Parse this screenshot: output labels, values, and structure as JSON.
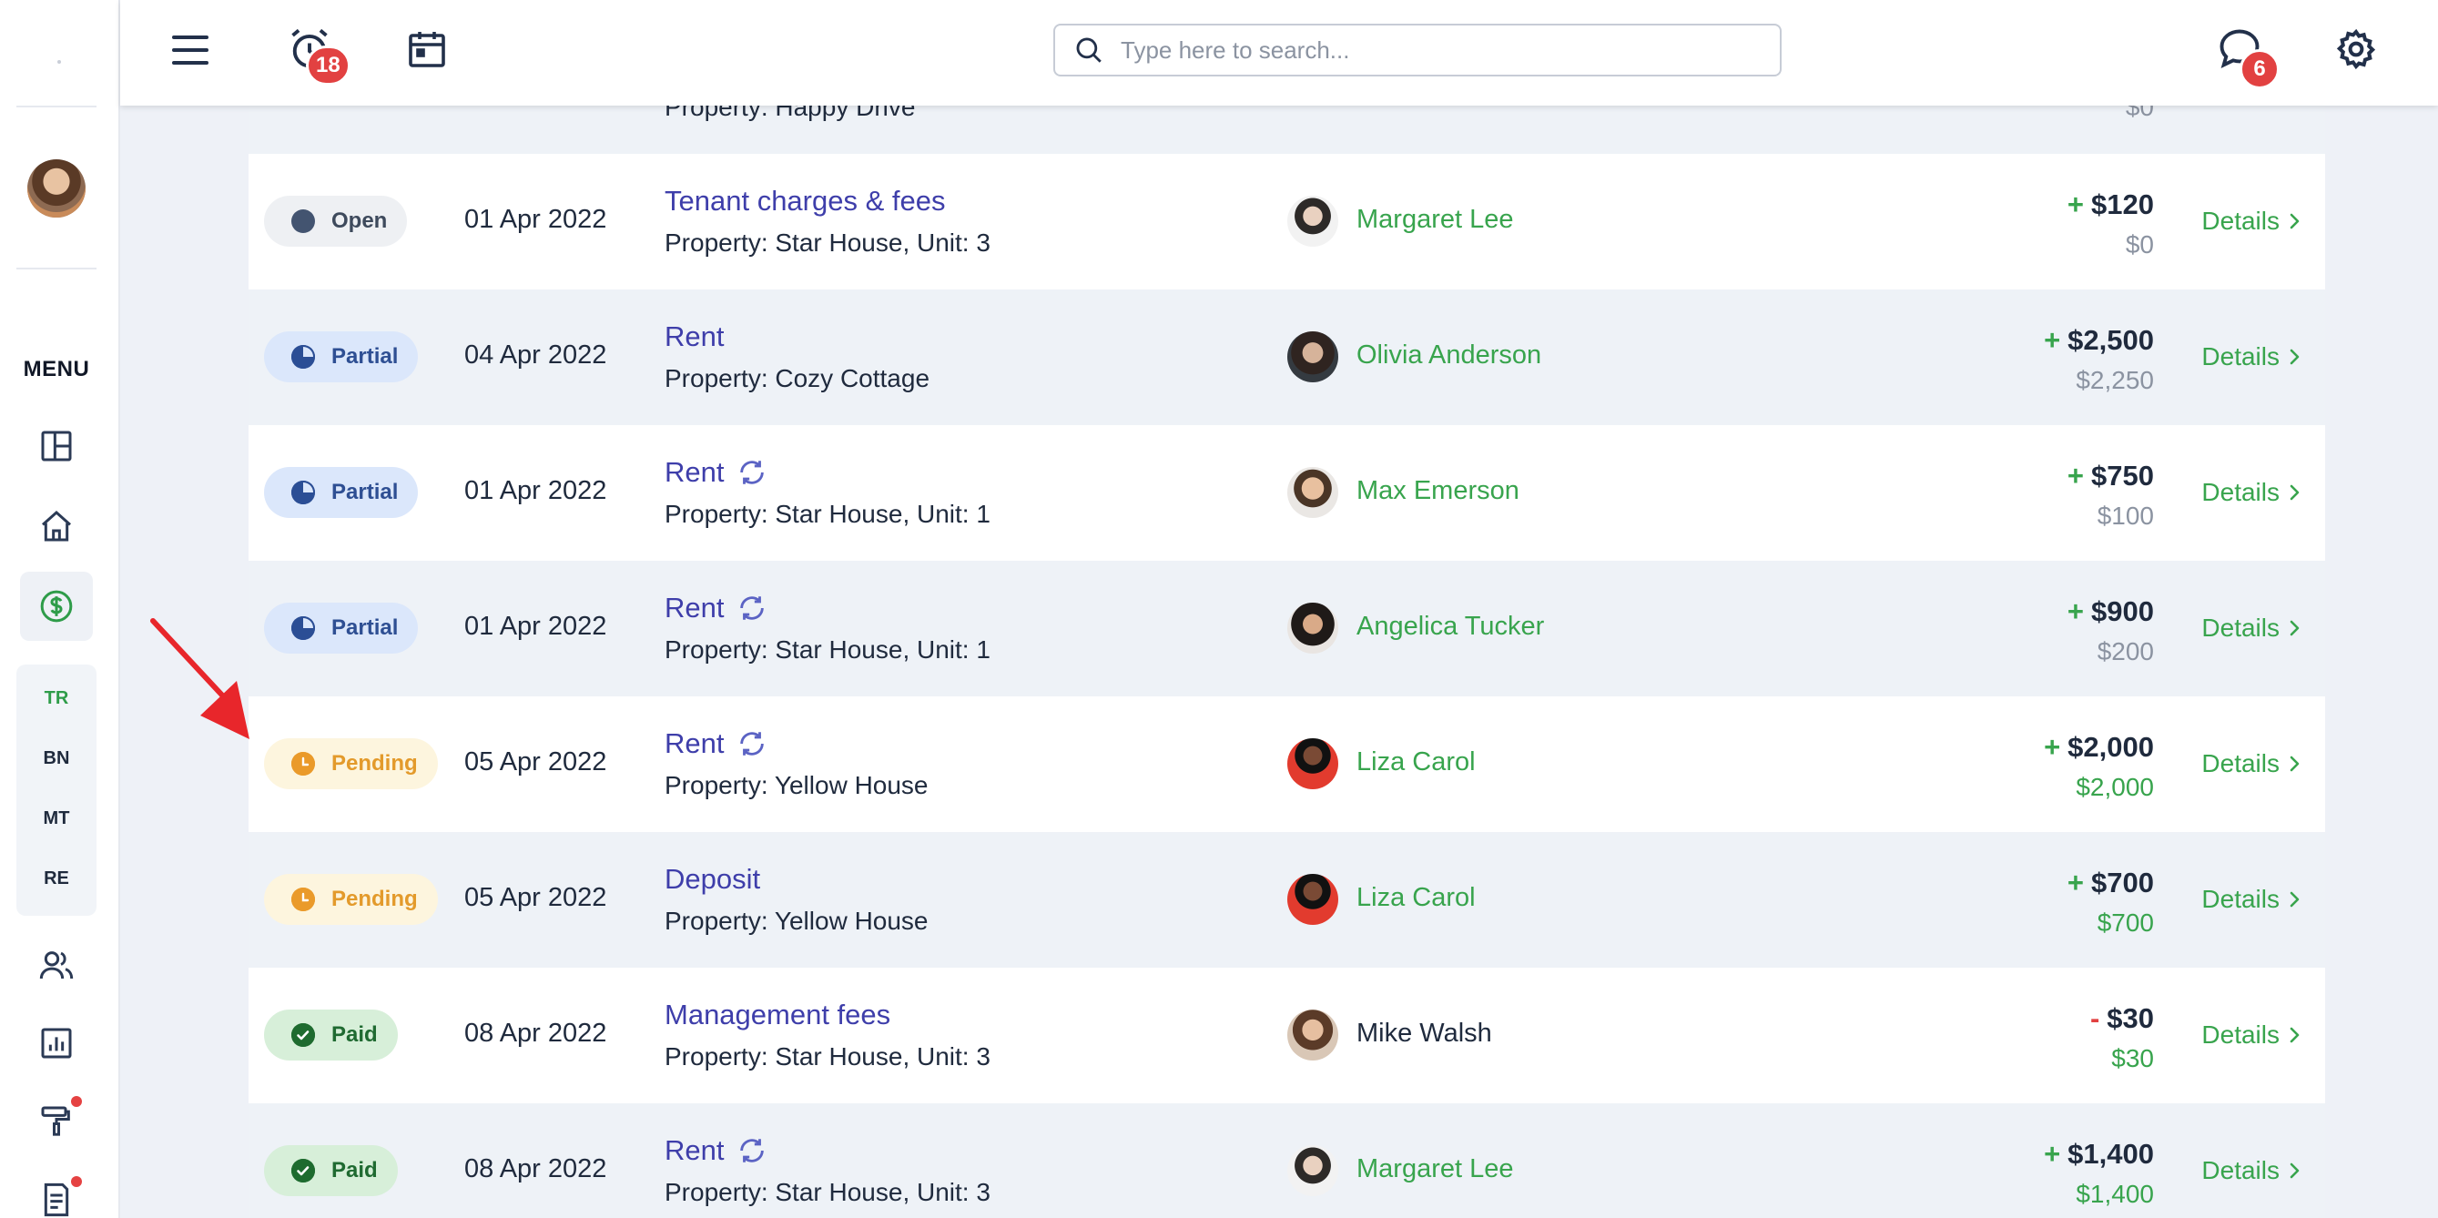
{
  "topbar": {
    "menu_icon": "hamburger-icon",
    "alarm_badge": "18",
    "search_placeholder": "Type here to search...",
    "messages_badge": "6"
  },
  "sidebar": {
    "menu_label": "MENU",
    "sub_items": [
      "TR",
      "BN",
      "MT",
      "RE"
    ]
  },
  "partial_row": {
    "property": "Property: Happy Drive",
    "paid": "$0"
  },
  "rows": [
    {
      "status": "Open",
      "date": "01 Apr 2022",
      "title": "Tenant charges & fees",
      "recurring": false,
      "property": "Property: Star House, Unit: 3",
      "person": "Margaret Lee",
      "sign": "+",
      "amount": "$120",
      "paid": "$0",
      "details": "Details"
    },
    {
      "status": "Partial",
      "date": "04 Apr 2022",
      "title": "Rent",
      "recurring": false,
      "property": "Property: Cozy Cottage",
      "person": "Olivia Anderson",
      "sign": "+",
      "amount": "$2,500",
      "paid": "$2,250",
      "details": "Details"
    },
    {
      "status": "Partial",
      "date": "01 Apr 2022",
      "title": "Rent",
      "recurring": true,
      "property": "Property: Star House, Unit: 1",
      "person": "Max Emerson",
      "sign": "+",
      "amount": "$750",
      "paid": "$100",
      "details": "Details"
    },
    {
      "status": "Partial",
      "date": "01 Apr 2022",
      "title": "Rent",
      "recurring": true,
      "property": "Property: Star House, Unit: 1",
      "person": "Angelica Tucker",
      "sign": "+",
      "amount": "$900",
      "paid": "$200",
      "details": "Details"
    },
    {
      "status": "Pending",
      "date": "05 Apr 2022",
      "title": "Rent",
      "recurring": true,
      "property": "Property: Yellow House",
      "person": "Liza Carol",
      "sign": "+",
      "amount": "$2,000",
      "paid": "$2,000",
      "details": "Details"
    },
    {
      "status": "Pending",
      "date": "05 Apr 2022",
      "title": "Deposit",
      "recurring": false,
      "property": "Property: Yellow House",
      "person": "Liza Carol",
      "sign": "+",
      "amount": "$700",
      "paid": "$700",
      "details": "Details"
    },
    {
      "status": "Paid",
      "date": "08 Apr 2022",
      "title": "Management fees",
      "recurring": false,
      "property": "Property: Star House, Unit: 3",
      "person": "Mike Walsh",
      "sign": "-",
      "amount": "$30",
      "paid": "$30",
      "details": "Details"
    },
    {
      "status": "Paid",
      "date": "08 Apr 2022",
      "title": "Rent",
      "recurring": true,
      "property": "Property: Star House, Unit: 3",
      "person": "Margaret Lee",
      "sign": "+",
      "amount": "$1,400",
      "paid": "$1,400",
      "details": "Details"
    }
  ],
  "colors": {
    "accent_green": "#38a44d",
    "title_blue": "#3e3eaa",
    "badge_red": "#e24141",
    "annotation_arrow": "#e8262b"
  }
}
